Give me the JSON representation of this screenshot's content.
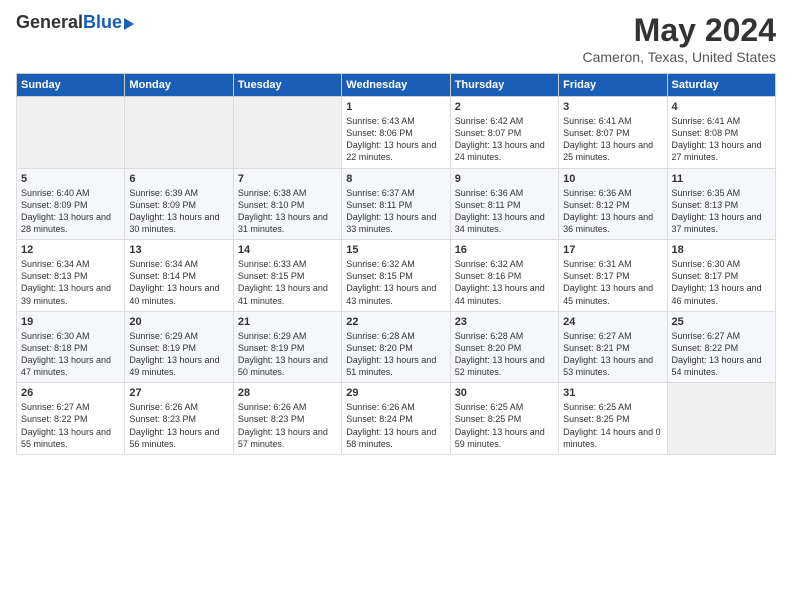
{
  "logo": {
    "general": "General",
    "blue": "Blue"
  },
  "title": "May 2024",
  "subtitle": "Cameron, Texas, United States",
  "headers": [
    "Sunday",
    "Monday",
    "Tuesday",
    "Wednesday",
    "Thursday",
    "Friday",
    "Saturday"
  ],
  "weeks": [
    [
      {
        "day": "",
        "empty": true
      },
      {
        "day": "",
        "empty": true
      },
      {
        "day": "",
        "empty": true
      },
      {
        "day": "1",
        "sunrise": "6:43 AM",
        "sunset": "8:06 PM",
        "daylight": "13 hours and 22 minutes."
      },
      {
        "day": "2",
        "sunrise": "6:42 AM",
        "sunset": "8:07 PM",
        "daylight": "13 hours and 24 minutes."
      },
      {
        "day": "3",
        "sunrise": "6:41 AM",
        "sunset": "8:07 PM",
        "daylight": "13 hours and 25 minutes."
      },
      {
        "day": "4",
        "sunrise": "6:41 AM",
        "sunset": "8:08 PM",
        "daylight": "13 hours and 27 minutes."
      }
    ],
    [
      {
        "day": "5",
        "sunrise": "6:40 AM",
        "sunset": "8:09 PM",
        "daylight": "13 hours and 28 minutes."
      },
      {
        "day": "6",
        "sunrise": "6:39 AM",
        "sunset": "8:09 PM",
        "daylight": "13 hours and 30 minutes."
      },
      {
        "day": "7",
        "sunrise": "6:38 AM",
        "sunset": "8:10 PM",
        "daylight": "13 hours and 31 minutes."
      },
      {
        "day": "8",
        "sunrise": "6:37 AM",
        "sunset": "8:11 PM",
        "daylight": "13 hours and 33 minutes."
      },
      {
        "day": "9",
        "sunrise": "6:36 AM",
        "sunset": "8:11 PM",
        "daylight": "13 hours and 34 minutes."
      },
      {
        "day": "10",
        "sunrise": "6:36 AM",
        "sunset": "8:12 PM",
        "daylight": "13 hours and 36 minutes."
      },
      {
        "day": "11",
        "sunrise": "6:35 AM",
        "sunset": "8:13 PM",
        "daylight": "13 hours and 37 minutes."
      }
    ],
    [
      {
        "day": "12",
        "sunrise": "6:34 AM",
        "sunset": "8:13 PM",
        "daylight": "13 hours and 39 minutes."
      },
      {
        "day": "13",
        "sunrise": "6:34 AM",
        "sunset": "8:14 PM",
        "daylight": "13 hours and 40 minutes."
      },
      {
        "day": "14",
        "sunrise": "6:33 AM",
        "sunset": "8:15 PM",
        "daylight": "13 hours and 41 minutes."
      },
      {
        "day": "15",
        "sunrise": "6:32 AM",
        "sunset": "8:15 PM",
        "daylight": "13 hours and 43 minutes."
      },
      {
        "day": "16",
        "sunrise": "6:32 AM",
        "sunset": "8:16 PM",
        "daylight": "13 hours and 44 minutes."
      },
      {
        "day": "17",
        "sunrise": "6:31 AM",
        "sunset": "8:17 PM",
        "daylight": "13 hours and 45 minutes."
      },
      {
        "day": "18",
        "sunrise": "6:30 AM",
        "sunset": "8:17 PM",
        "daylight": "13 hours and 46 minutes."
      }
    ],
    [
      {
        "day": "19",
        "sunrise": "6:30 AM",
        "sunset": "8:18 PM",
        "daylight": "13 hours and 47 minutes."
      },
      {
        "day": "20",
        "sunrise": "6:29 AM",
        "sunset": "8:19 PM",
        "daylight": "13 hours and 49 minutes."
      },
      {
        "day": "21",
        "sunrise": "6:29 AM",
        "sunset": "8:19 PM",
        "daylight": "13 hours and 50 minutes."
      },
      {
        "day": "22",
        "sunrise": "6:28 AM",
        "sunset": "8:20 PM",
        "daylight": "13 hours and 51 minutes."
      },
      {
        "day": "23",
        "sunrise": "6:28 AM",
        "sunset": "8:20 PM",
        "daylight": "13 hours and 52 minutes."
      },
      {
        "day": "24",
        "sunrise": "6:27 AM",
        "sunset": "8:21 PM",
        "daylight": "13 hours and 53 minutes."
      },
      {
        "day": "25",
        "sunrise": "6:27 AM",
        "sunset": "8:22 PM",
        "daylight": "13 hours and 54 minutes."
      }
    ],
    [
      {
        "day": "26",
        "sunrise": "6:27 AM",
        "sunset": "8:22 PM",
        "daylight": "13 hours and 55 minutes."
      },
      {
        "day": "27",
        "sunrise": "6:26 AM",
        "sunset": "8:23 PM",
        "daylight": "13 hours and 56 minutes."
      },
      {
        "day": "28",
        "sunrise": "6:26 AM",
        "sunset": "8:23 PM",
        "daylight": "13 hours and 57 minutes."
      },
      {
        "day": "29",
        "sunrise": "6:26 AM",
        "sunset": "8:24 PM",
        "daylight": "13 hours and 58 minutes."
      },
      {
        "day": "30",
        "sunrise": "6:25 AM",
        "sunset": "8:25 PM",
        "daylight": "13 hours and 59 minutes."
      },
      {
        "day": "31",
        "sunrise": "6:25 AM",
        "sunset": "8:25 PM",
        "daylight": "14 hours and 0 minutes."
      },
      {
        "day": "",
        "empty": true
      }
    ]
  ]
}
